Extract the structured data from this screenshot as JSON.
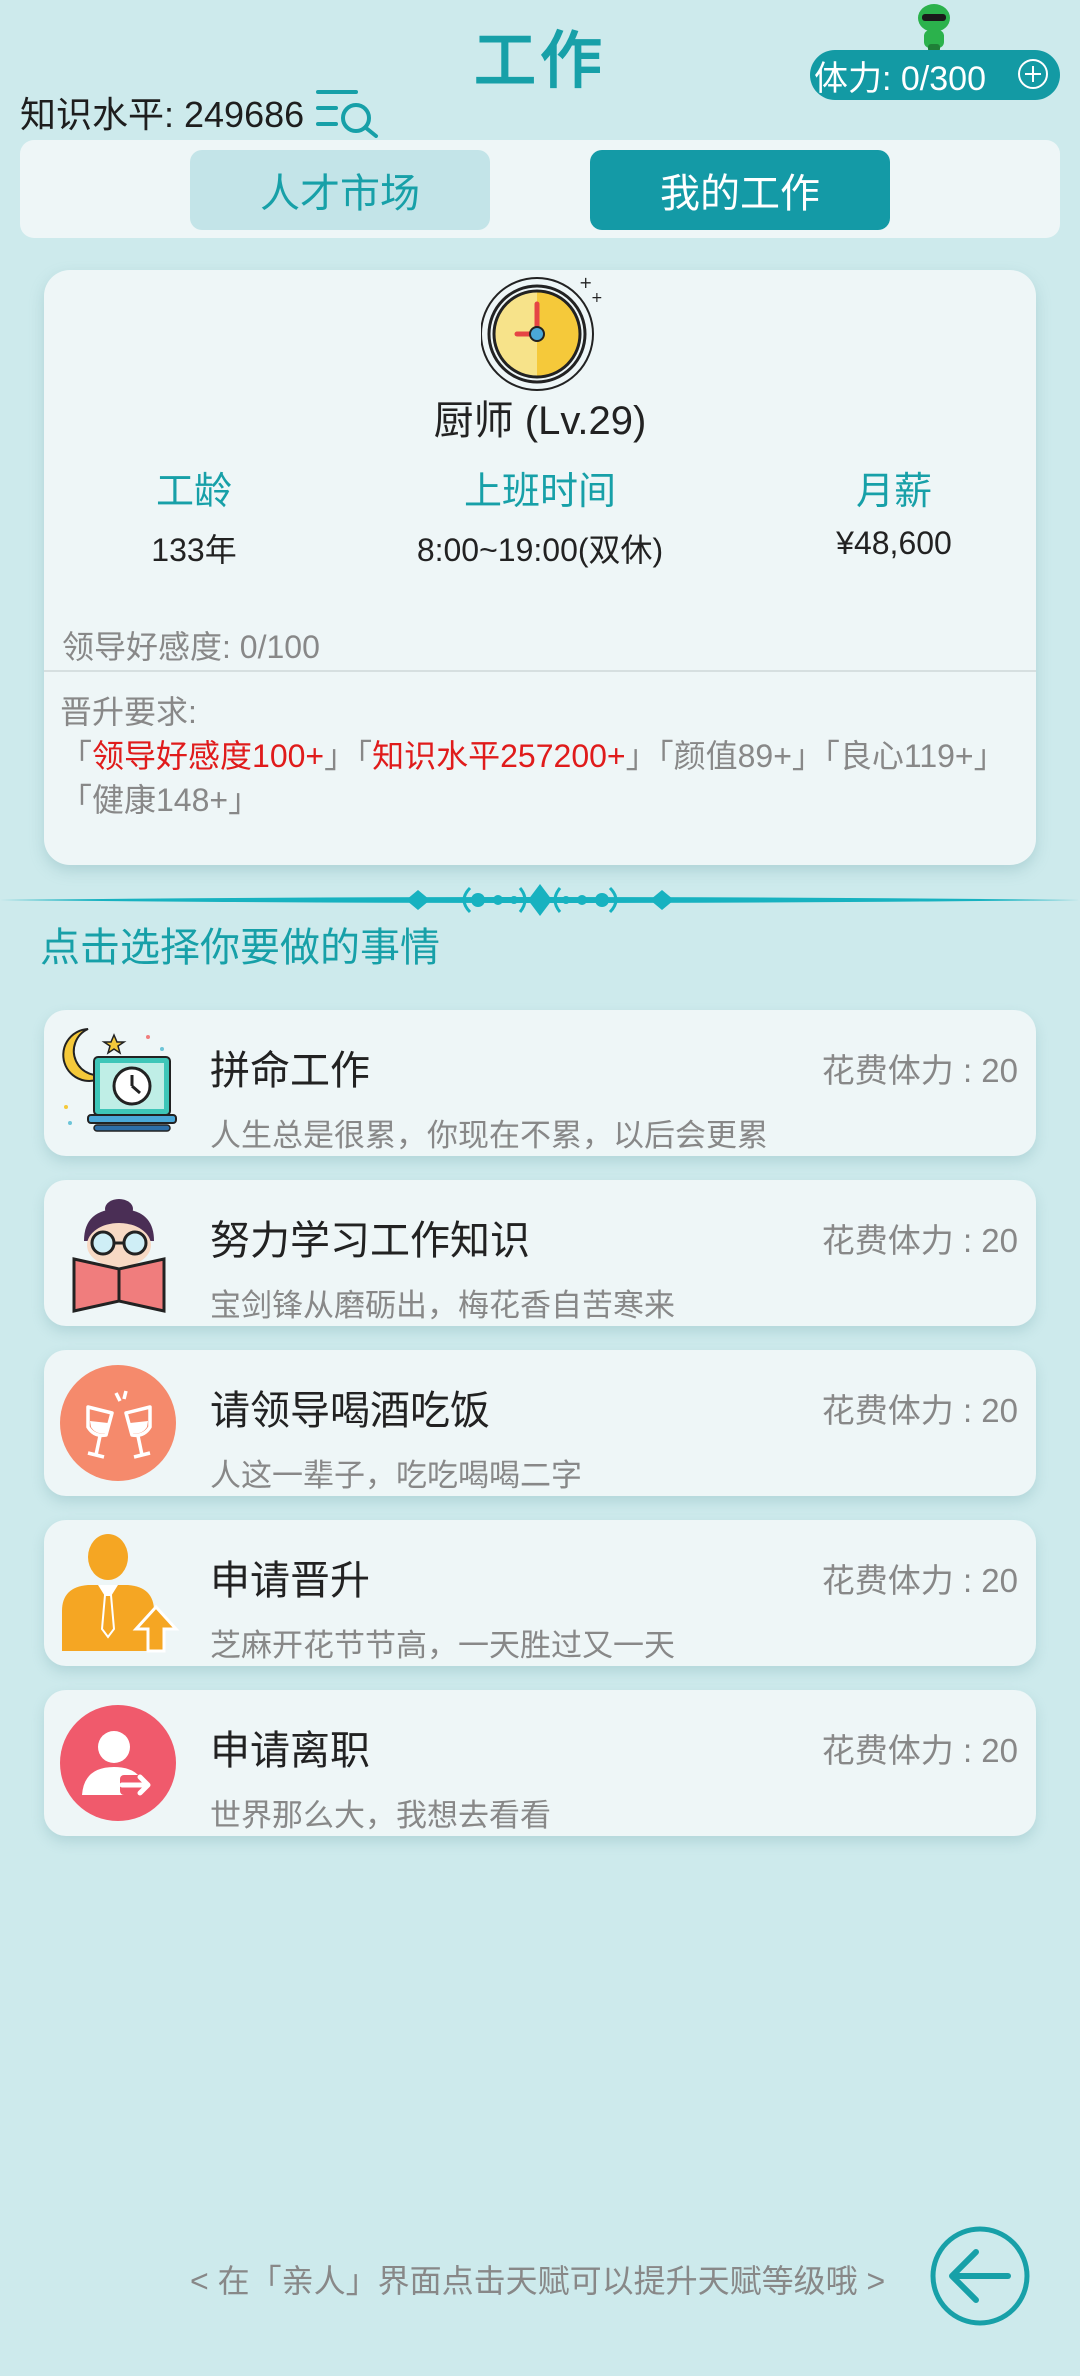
{
  "header": {
    "title": "工作",
    "knowledge_label": "知识水平: 249686",
    "stamina_label": "体力: 0/300"
  },
  "tabs": [
    {
      "label": "人才市场",
      "active": false
    },
    {
      "label": "我的工作",
      "active": true
    }
  ],
  "job": {
    "title": "厨师 (Lv.29)",
    "stats": [
      {
        "label": "工龄",
        "value": "133年"
      },
      {
        "label": "上班时间",
        "value": "8:00~19:00(双休)"
      },
      {
        "label": "月薪",
        "value": "¥48,600"
      }
    ],
    "favor": "领导好感度: 0/100",
    "req_title": "晋升要求:",
    "req_parts": [
      {
        "text": "「",
        "red": false
      },
      {
        "text": "领导好感度100+",
        "red": true
      },
      {
        "text": "」「",
        "red": false
      },
      {
        "text": "知识水平257200+",
        "red": true
      },
      {
        "text": "」「颜值89+」「良心119+」「健康148+」",
        "red": false
      }
    ]
  },
  "prompt": "点击选择你要做的事情",
  "actions": [
    {
      "name": "拼命工作",
      "cost": "花费体力 : 20",
      "desc": "人生总是很累，你现在不累，以后会更累",
      "icon": "work-night-icon"
    },
    {
      "name": "努力学习工作知识",
      "cost": "花费体力 : 20",
      "desc": "宝剑锋从磨砺出，梅花香自苦寒来",
      "icon": "study-icon"
    },
    {
      "name": "请领导喝酒吃饭",
      "cost": "花费体力 : 20",
      "desc": "人这一辈子，吃吃喝喝二字",
      "icon": "cheers-icon"
    },
    {
      "name": "申请晋升",
      "cost": "花费体力 : 20",
      "desc": "芝麻开花节节高，一天胜过又一天",
      "icon": "promotion-icon"
    },
    {
      "name": "申请离职",
      "cost": "花费体力 : 20",
      "desc": "世界那么大，我想去看看",
      "icon": "resign-icon"
    }
  ],
  "footer": {
    "hint": "< 在「亲人」界面点击天赋可以提升天赋等级哦 >"
  },
  "colors": {
    "accent": "#17a0a8",
    "background": "#cdeaec",
    "card": "#eef6f7",
    "warning": "#e01b1b"
  }
}
